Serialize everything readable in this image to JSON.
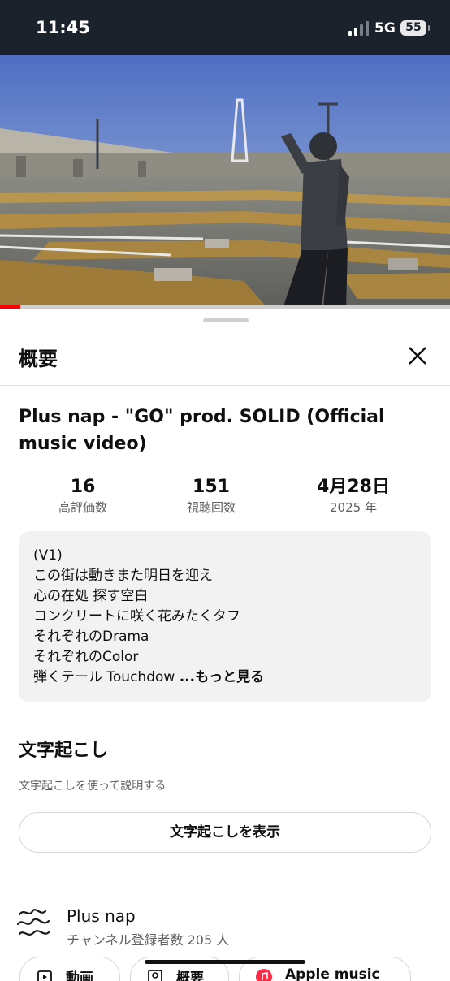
{
  "status_bar": {
    "time": "11:45",
    "network": "5G",
    "battery": "55"
  },
  "video": {
    "progress": 0.045
  },
  "sheet": {
    "title": "概要",
    "video_title": "Plus nap -  \"GO\"  prod. SOLID (Official music video)",
    "stats": [
      {
        "value": "16",
        "label": "高評価数"
      },
      {
        "value": "151",
        "label": "視聴回数"
      },
      {
        "value": "4月28日",
        "label": "2025 年"
      }
    ],
    "description": {
      "lines": [
        "(V1)",
        "この街は動きまた明日を迎え",
        "心の在処 探す空白",
        "コンクリートに咲く花みたくタフ",
        "それぞれのDrama",
        "それぞれのColor",
        "弾くテール Touchdow"
      ],
      "more": "...もっと見る"
    },
    "transcript": {
      "title": "文字起こし",
      "subtitle": "文字起こしを使って説明する",
      "button": "文字起こしを表示"
    },
    "channel": {
      "name": "Plus nap",
      "subscribers": "チャンネル登録者数 205 人"
    },
    "chips": [
      "動画",
      "概要",
      "Apple music"
    ]
  },
  "colors": {
    "accent": "#ff0000",
    "status_bar": "#1c222c"
  }
}
